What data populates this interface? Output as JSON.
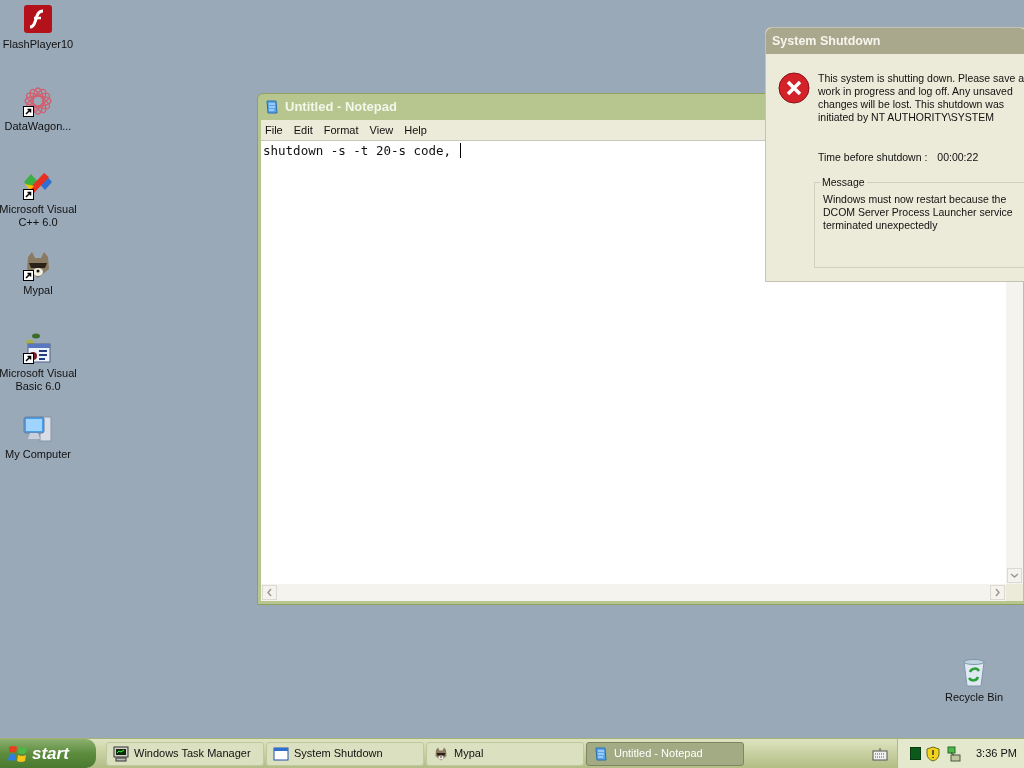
{
  "desktop": {
    "icons": [
      {
        "label": "FlashPlayer10",
        "kind": "flash",
        "shortcut": false
      },
      {
        "label": "DataWagon...",
        "kind": "datawagon",
        "shortcut": true
      },
      {
        "label": "Microsoft Visual C++ 6.0",
        "kind": "vcpp",
        "shortcut": true
      },
      {
        "label": "Mypal",
        "kind": "mypal",
        "shortcut": true
      },
      {
        "label": "Microsoft Visual Basic 6.0",
        "kind": "vb",
        "shortcut": true
      },
      {
        "label": "My Computer",
        "kind": "computer",
        "shortcut": false
      },
      {
        "label": "Recycle Bin",
        "kind": "recycle",
        "shortcut": false
      }
    ]
  },
  "notepad": {
    "title": "Untitled - Notepad",
    "menu": [
      "File",
      "Edit",
      "Format",
      "View",
      "Help"
    ],
    "text": "shutdown -s -t 20-s code,"
  },
  "dialog": {
    "title": "System Shutdown",
    "message_lines": [
      "This system is shutting down. Please save a",
      "work in progress and log off. Any unsaved",
      "changes will be lost. This shutdown was",
      "initiated by NT AUTHORITY\\SYSTEM"
    ],
    "time_label": "Time before shutdown :",
    "time_value": "00:00:22",
    "group_label": "Message",
    "group_lines": [
      "Windows must now restart because the",
      "DCOM Server Process Launcher service",
      "terminated unexpectedly"
    ]
  },
  "taskbar": {
    "start": "start",
    "tasks": [
      {
        "label": "Windows Task Manager",
        "kind": "taskmgr",
        "selected": false
      },
      {
        "label": "System Shutdown",
        "kind": "window",
        "selected": false
      },
      {
        "label": "Mypal",
        "kind": "mypal",
        "selected": false
      },
      {
        "label": "Untitled - Notepad",
        "kind": "notepad",
        "selected": true
      }
    ],
    "clock": "3:36 PM"
  }
}
